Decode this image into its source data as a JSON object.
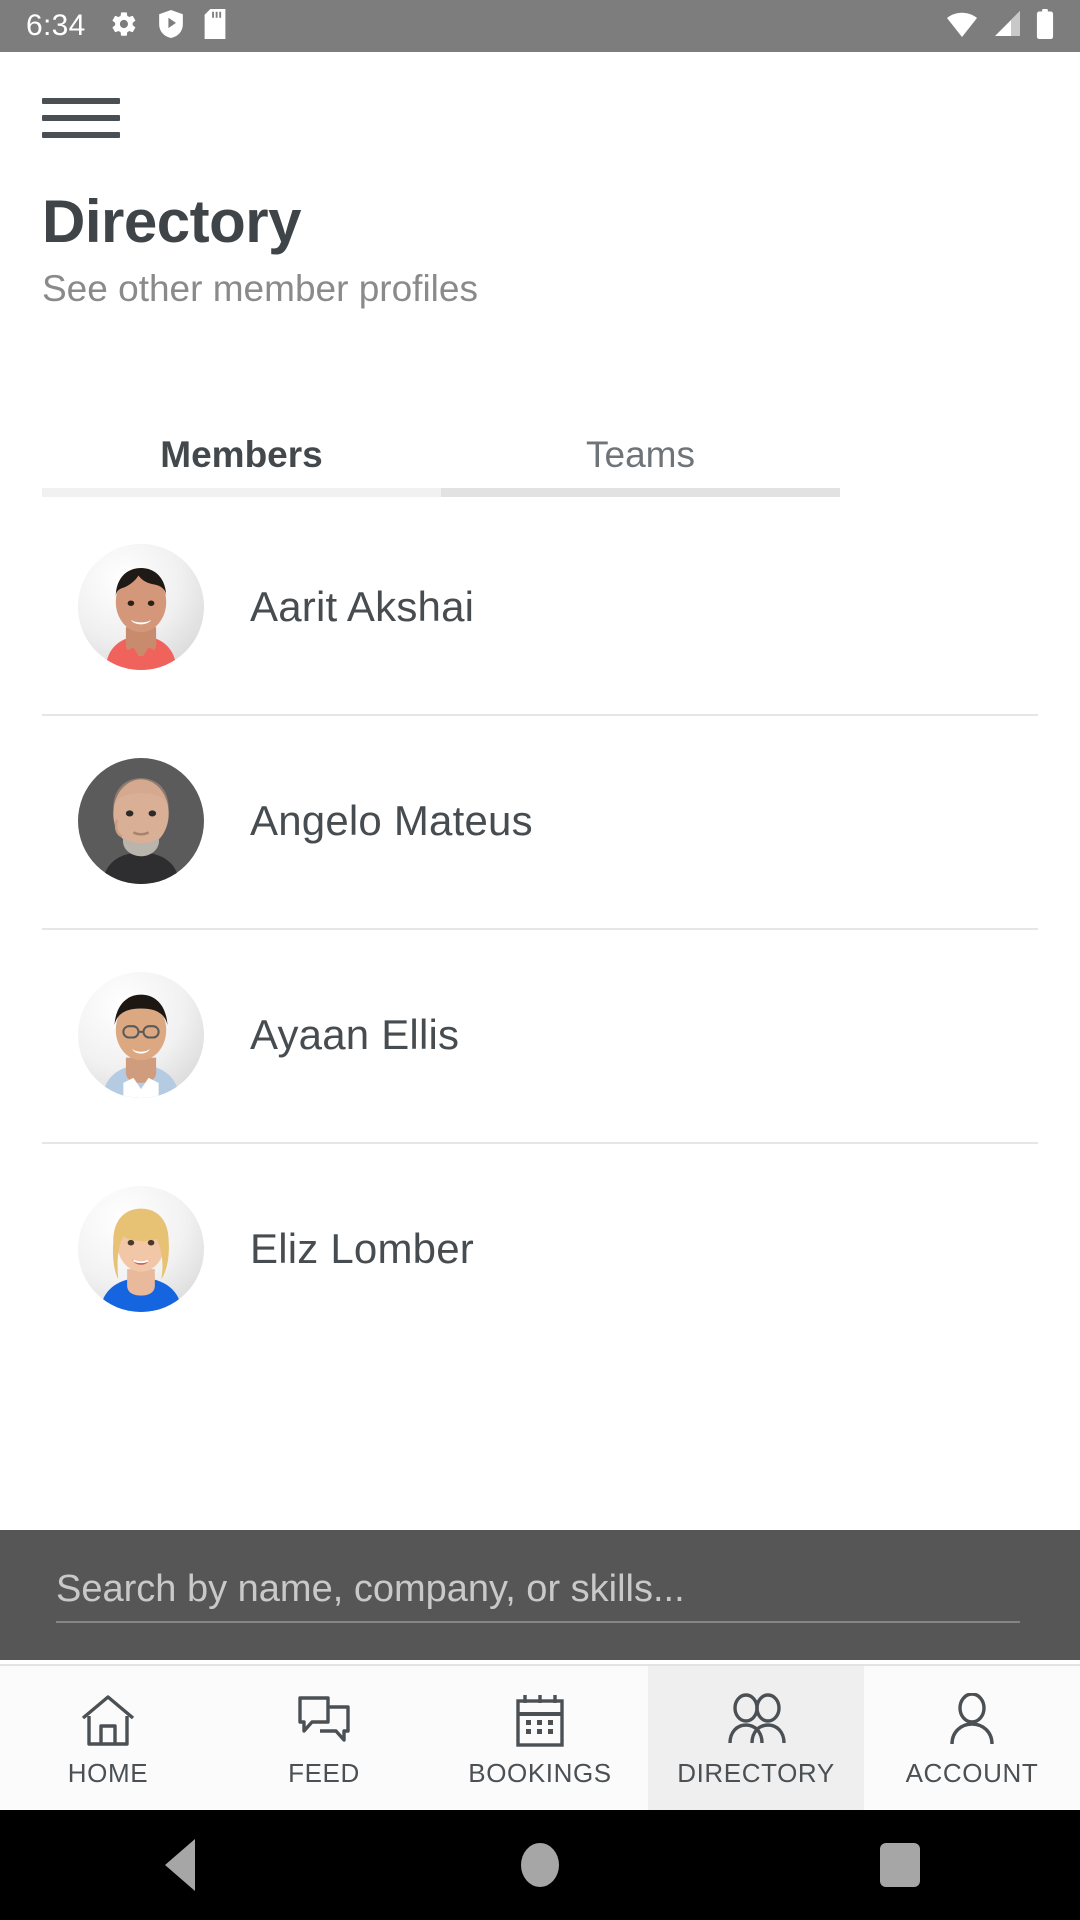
{
  "status_bar": {
    "time": "6:34",
    "left_icons": [
      "gear-icon",
      "shield-play-icon",
      "sd-card-icon"
    ],
    "right_icons": [
      "wifi-icon",
      "cellular-signal-icon",
      "battery-icon"
    ],
    "background_color": "#7d7d7d"
  },
  "appbar": {
    "menu_icon": "hamburger-menu-icon"
  },
  "header": {
    "title": "Directory",
    "subtitle": "See other member profiles"
  },
  "tabs": {
    "items": [
      {
        "label": "Members",
        "active": true
      },
      {
        "label": "Teams",
        "active": false
      }
    ]
  },
  "members": [
    {
      "name": "Aarit Akshai",
      "avatar": "photo-male-red-polo"
    },
    {
      "name": "Angelo Mateus",
      "avatar": "photo-male-bald-beard"
    },
    {
      "name": "Ayaan Ellis",
      "avatar": "photo-male-glasses-blue-shirt"
    },
    {
      "name": "Eliz Lomber",
      "avatar": "photo-female-blonde-blue-top"
    }
  ],
  "search": {
    "placeholder": "Search by name, company, or skills...",
    "value": ""
  },
  "bottom_nav": {
    "items": [
      {
        "label": "HOME",
        "icon": "home-icon",
        "selected": false
      },
      {
        "label": "FEED",
        "icon": "chat-bubbles-icon",
        "selected": false
      },
      {
        "label": "BOOKINGS",
        "icon": "calendar-icon",
        "selected": false
      },
      {
        "label": "DIRECTORY",
        "icon": "people-group-icon",
        "selected": true
      },
      {
        "label": "ACCOUNT",
        "icon": "person-icon",
        "selected": false
      }
    ]
  },
  "android_nav": {
    "back": "back-triangle-icon",
    "home": "home-circle-icon",
    "recents": "recents-square-icon"
  },
  "colors": {
    "status_bar": "#7d7d7d",
    "title_text": "#3f4448",
    "subtitle_text": "#8a8a8a",
    "divider": "#e6e6e6",
    "selected_nav_bg": "#efefef"
  }
}
